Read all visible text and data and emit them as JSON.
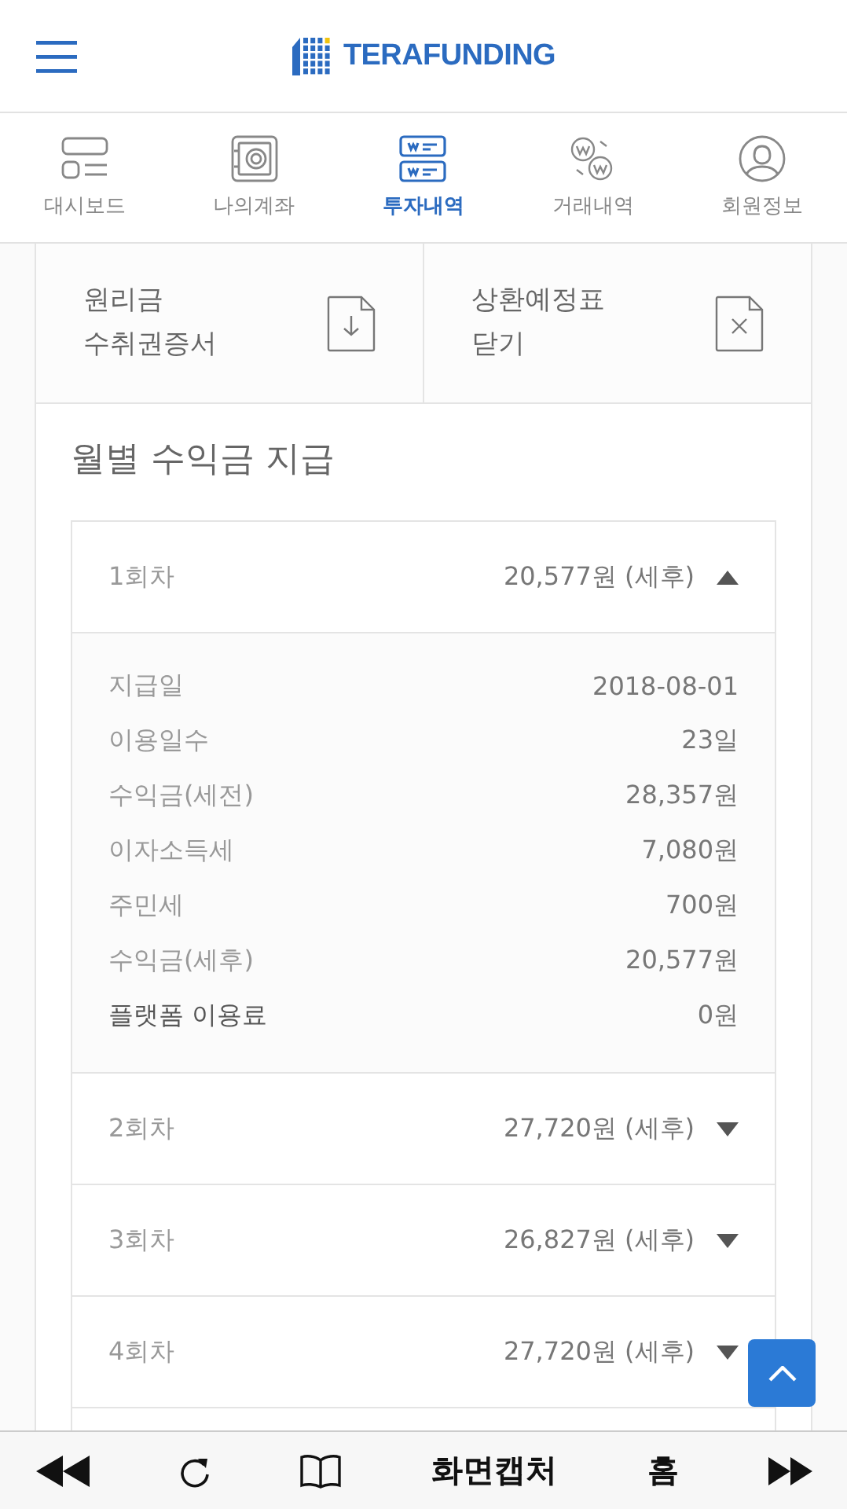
{
  "header": {
    "logo": "TERAFUNDING"
  },
  "tabs": [
    {
      "label": "대시보드",
      "kind": "dashboard",
      "selected": false
    },
    {
      "label": "나의계좌",
      "kind": "safe",
      "selected": false
    },
    {
      "label": "투자내역",
      "kind": "invest",
      "selected": true
    },
    {
      "label": "거래내역",
      "kind": "exchange",
      "selected": false
    },
    {
      "label": "회원정보",
      "kind": "user",
      "selected": false
    }
  ],
  "actions": [
    {
      "label": "원리금\n수취권증서",
      "kind": "download"
    },
    {
      "label": "상환예정표\n닫기",
      "kind": "close"
    }
  ],
  "section_title": "월별 수익금 지급",
  "payments": [
    {
      "round": "1회차",
      "amount": "20,577원 (세후)",
      "expanded": true,
      "details": [
        {
          "label": "지급일",
          "value": "2018-08-01",
          "kind": "normal"
        },
        {
          "label": "이용일수",
          "value": "23일",
          "kind": "normal"
        },
        {
          "label": "수익금(세전)",
          "value": "28,357원",
          "kind": "normal"
        },
        {
          "label": "이자소득세",
          "value": "7,080원",
          "kind": "normal"
        },
        {
          "label": "주민세",
          "value": "700원",
          "kind": "normal"
        },
        {
          "label": "수익금(세후)",
          "value": "20,577원",
          "kind": "normal"
        },
        {
          "label": "플랫폼 이용료",
          "value": "0원",
          "kind": "strong"
        }
      ]
    },
    {
      "round": "2회차",
      "amount": "27,720원 (세후)",
      "expanded": false
    },
    {
      "round": "3회차",
      "amount": "26,827원 (세후)",
      "expanded": false
    },
    {
      "round": "4회차",
      "amount": "27,720원 (세후)",
      "expanded": false
    }
  ],
  "toolbar": {
    "capture": "화면캡처",
    "home": "홈"
  }
}
